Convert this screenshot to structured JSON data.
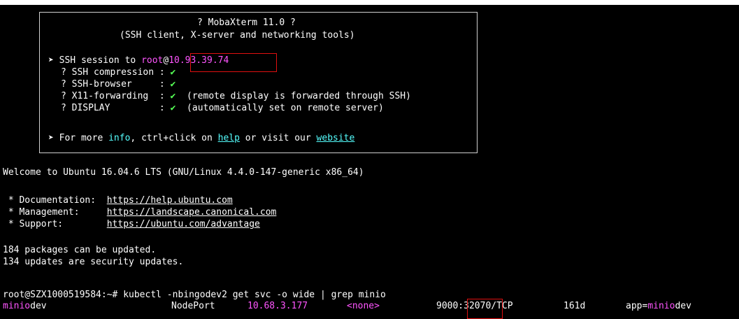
{
  "banner": {
    "title": "? MobaXterm 11.0 ?",
    "subtitle": "(SSH client, X-server and networking tools)",
    "ssh_session": {
      "bullet": "➤",
      "prefix": "SSH session to ",
      "user": "root",
      "at": "@",
      "host": "10.93.39.74"
    },
    "features": [
      {
        "q": "?",
        "name": "SSH compression",
        "sep": ":",
        "check": "✔",
        "note": ""
      },
      {
        "q": "?",
        "name": "SSH-browser",
        "sep": ":",
        "check": "✔",
        "note": ""
      },
      {
        "q": "?",
        "name": "X11-forwarding",
        "sep": ":",
        "check": "✔",
        "note": "(remote display is forwarded through SSH)"
      },
      {
        "q": "?",
        "name": "DISPLAY",
        "sep": ":",
        "check": "✔",
        "note": "(automatically set on remote server)"
      }
    ],
    "more_info": {
      "bullet": "➤",
      "prefix": "For more ",
      "info": "info",
      "mid": ", ctrl+click on ",
      "help": "help",
      "mid2": " or visit our ",
      "website": "website"
    }
  },
  "welcome": "Welcome to Ubuntu 16.04.6 LTS (GNU/Linux 4.4.0-147-generic x86_64)",
  "links": [
    {
      "label": " * Documentation:",
      "url": "https://help.ubuntu.com"
    },
    {
      "label": " * Management:",
      "url": "https://landscape.canonical.com"
    },
    {
      "label": " * Support:",
      "url": "https://ubuntu.com/advantage"
    }
  ],
  "updates": [
    "184 packages can be updated.",
    "134 updates are security updates."
  ],
  "prompt": {
    "text": "root@SZX1000519584:~# ",
    "command": "kubectl -nbingodev2 get svc -o wide | grep minio"
  },
  "result_row": {
    "name_match": "minio",
    "name_rest": "dev",
    "type": "NodePort",
    "cluster_ip": "10.68.3.177",
    "external_ip": "<none>",
    "port_prefix": "9000:",
    "node_port": "32070",
    "port_suffix": "/TCP",
    "age": "161d",
    "selector_prefix": "app=",
    "selector_match": "minio",
    "selector_rest": "dev"
  },
  "colors": {
    "background": "#000000",
    "text": "#ffffff",
    "magenta": "#ff55ff",
    "green": "#55ff55",
    "cyan": "#55ffff",
    "highlight_box": "#e01010"
  }
}
